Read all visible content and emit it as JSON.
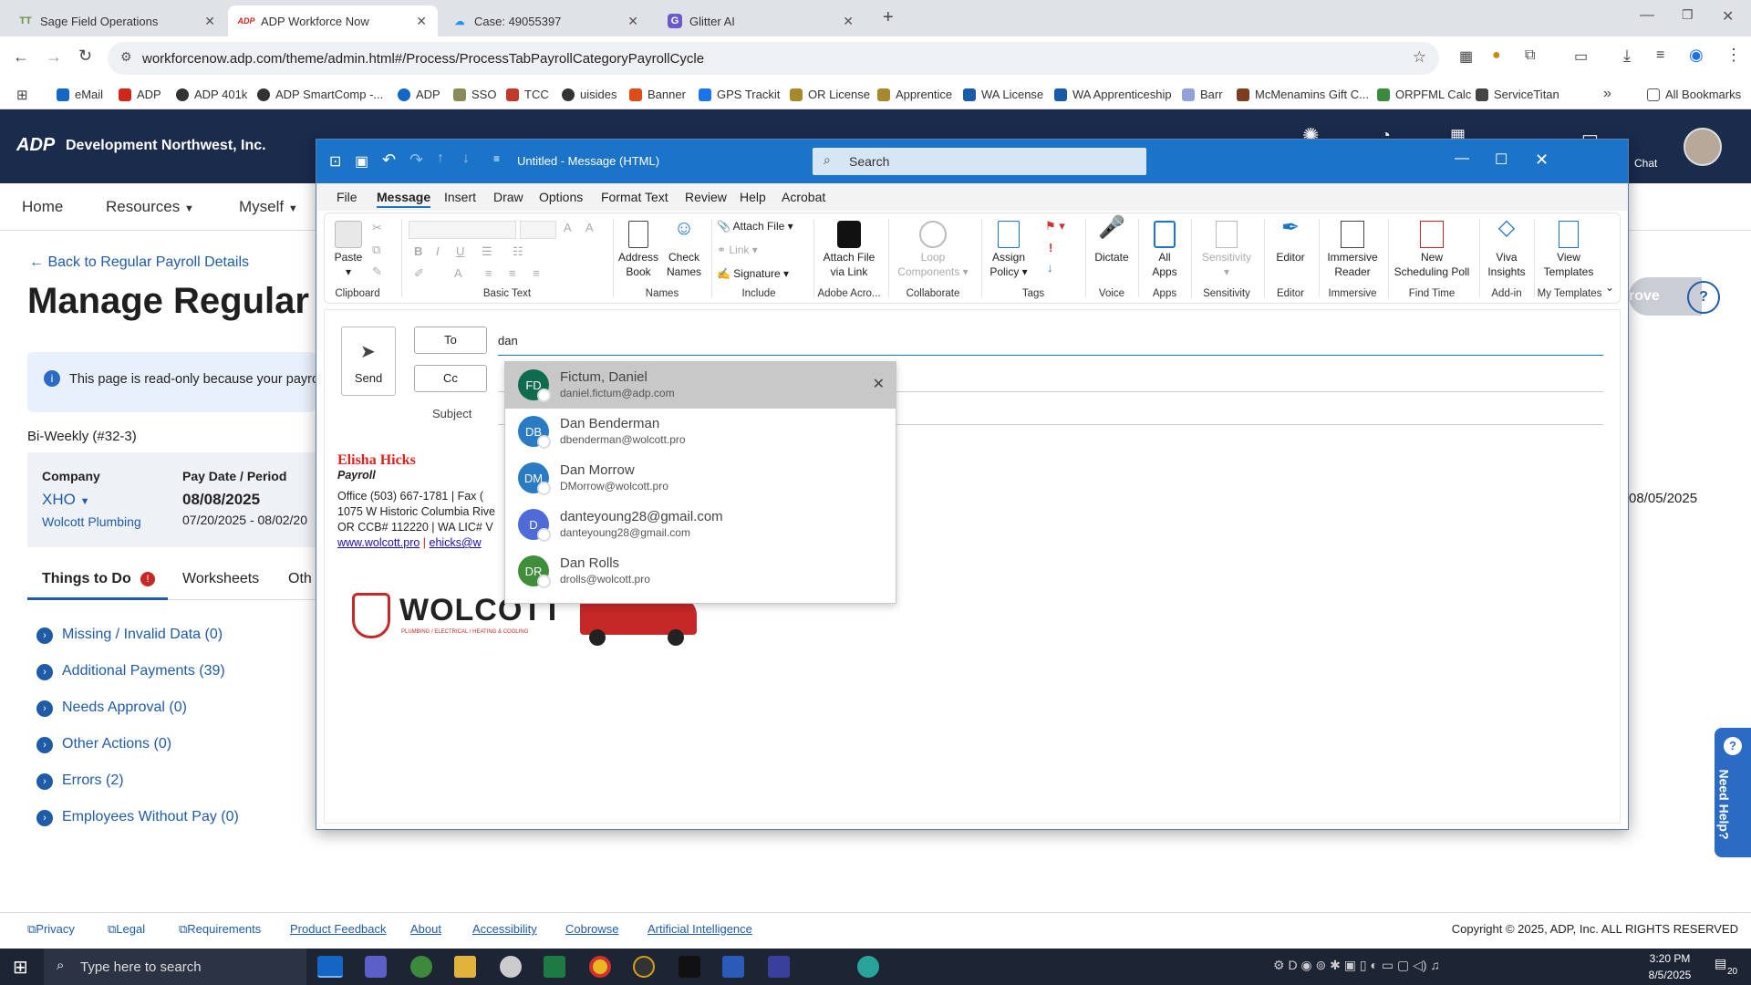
{
  "browser": {
    "tabs": [
      {
        "title": "Sage Field Operations",
        "icon": "TT"
      },
      {
        "title": "ADP Workforce Now",
        "icon": "ADP"
      },
      {
        "title": "Case: 49055397",
        "icon": "cloud"
      },
      {
        "title": "Glitter AI",
        "icon": "G"
      }
    ],
    "url": "workforcenow.adp.com/theme/admin.html#/Process/ProcessTabPayrollCategoryPayrollCycle",
    "bookmarks": [
      "eMail",
      "ADP",
      "ADP 401k",
      "ADP SmartComp -...",
      "ADP",
      "SSO",
      "TCC",
      "uisides",
      "Banner",
      "GPS Trackit",
      "OR License",
      "Apprentice",
      "WA License",
      "WA Apprenticeship",
      "Barr",
      "McMenamins Gift C...",
      "ORPFML Calc",
      "ServiceTitan"
    ],
    "all_bookmarks": "All Bookmarks"
  },
  "adp": {
    "company_name": "Development Northwest, Inc.",
    "logo": "ADP",
    "chat": "Chat",
    "nav": [
      "Home",
      "Resources",
      "Myself"
    ],
    "back_link": "Back to Regular Payroll Details",
    "page_title": "Manage Regular",
    "readonly_notice": "This page is read-only because your payroll",
    "cycle": "Bi-Weekly (#32-3)",
    "company_label": "Company",
    "company_code": "XHO",
    "company_sub": "Wolcott Plumbing",
    "paydate_label": "Pay Date / Period",
    "paydate": "08/08/2025",
    "period": "07/20/2025 - 08/02/20",
    "right_date": "08/05/2025",
    "approve": "rove",
    "tabs": [
      "Things to Do",
      "Worksheets",
      "Oth"
    ],
    "todo": [
      "Missing / Invalid Data (0)",
      "Additional Payments (39)",
      "Needs Approval (0)",
      "Other Actions (0)",
      "Errors (2)",
      "Employees Without Pay (0)"
    ],
    "need_help": "Need Help?",
    "footer_links": [
      "Privacy",
      "Legal",
      "Requirements",
      "Product Feedback",
      "About",
      "Accessibility",
      "Cobrowse",
      "Artificial Intelligence"
    ],
    "copyright": "Copyright © 2025, ADP, Inc. ALL RIGHTS RESERVED"
  },
  "outlook": {
    "title": "Untitled - Message (HTML)",
    "search_placeholder": "Search",
    "menu": [
      "File",
      "Message",
      "Insert",
      "Draw",
      "Options",
      "Format Text",
      "Review",
      "Help",
      "Acrobat"
    ],
    "ribbon": {
      "paste": "Paste",
      "clipboard": "Clipboard",
      "basic_text": "Basic Text",
      "address_book": [
        "Address",
        "Book"
      ],
      "check_names": [
        "Check",
        "Names"
      ],
      "names": "Names",
      "attach_file": "Attach File",
      "link": "Link",
      "signature": "Signature",
      "include": "Include",
      "attach_via_link": [
        "Attach File",
        "via Link"
      ],
      "adobe": "Adobe Acro...",
      "loop": [
        "Loop",
        "Components"
      ],
      "collaborate": "Collaborate",
      "assign_policy": [
        "Assign",
        "Policy"
      ],
      "tags": "Tags",
      "dictate": "Dictate",
      "voice": "Voice",
      "all_apps": [
        "All",
        "Apps"
      ],
      "apps": "Apps",
      "sensitivity_btn": "Sensitivity",
      "sensitivity": "Sensitivity",
      "editor_btn": "Editor",
      "editor": "Editor",
      "immersive_reader": [
        "Immersive",
        "Reader"
      ],
      "immersive": "Immersive",
      "scheduling_poll": [
        "New",
        "Scheduling Poll"
      ],
      "find_time": "Find Time",
      "viva_insights": [
        "Viva",
        "Insights"
      ],
      "add_in": "Add-in",
      "view_templates": [
        "View",
        "Templates"
      ],
      "my_templates": "My Templates"
    },
    "send": "Send",
    "to_label": "To",
    "cc_label": "Cc",
    "subject_label": "Subject",
    "to_value": "dan",
    "signature": {
      "name": "Elisha Hicks",
      "role": "Payroll",
      "line1": "Office (503) 667-1781 | Fax (",
      "line2": "1075 W Historic Columbia Rive",
      "line3": "OR CCB# 112220 | WA LIC# V",
      "web": "www.wolcott.pro",
      "email": "ehicks@w",
      "logo_text": "WOLCOTT",
      "logo_tag": "PLUMBING / ELECTRICAL / HEATING & COOLING"
    },
    "suggestions": [
      {
        "initials": "FD",
        "name": "Fictum, Daniel",
        "email": "daniel.fictum@adp.com",
        "color": "#0e6b4e"
      },
      {
        "initials": "DB",
        "name": "Dan Benderman",
        "email": "dbenderman@wolcott.pro",
        "color": "#2a7ac4"
      },
      {
        "initials": "DM",
        "name": "Dan Morrow",
        "email": "DMorrow@wolcott.pro",
        "color": "#2a7ac4"
      },
      {
        "initials": "D",
        "name": "danteyoung28@gmail.com",
        "email": "danteyoung28@gmail.com",
        "color": "#4f6bd8"
      },
      {
        "initials": "DR",
        "name": "Dan Rolls",
        "email": "drolls@wolcott.pro",
        "color": "#3f8f3a"
      }
    ]
  },
  "taskbar": {
    "search_placeholder": "Type here to search",
    "time": "3:20 PM",
    "date": "8/5/2025",
    "notifications": "20"
  }
}
